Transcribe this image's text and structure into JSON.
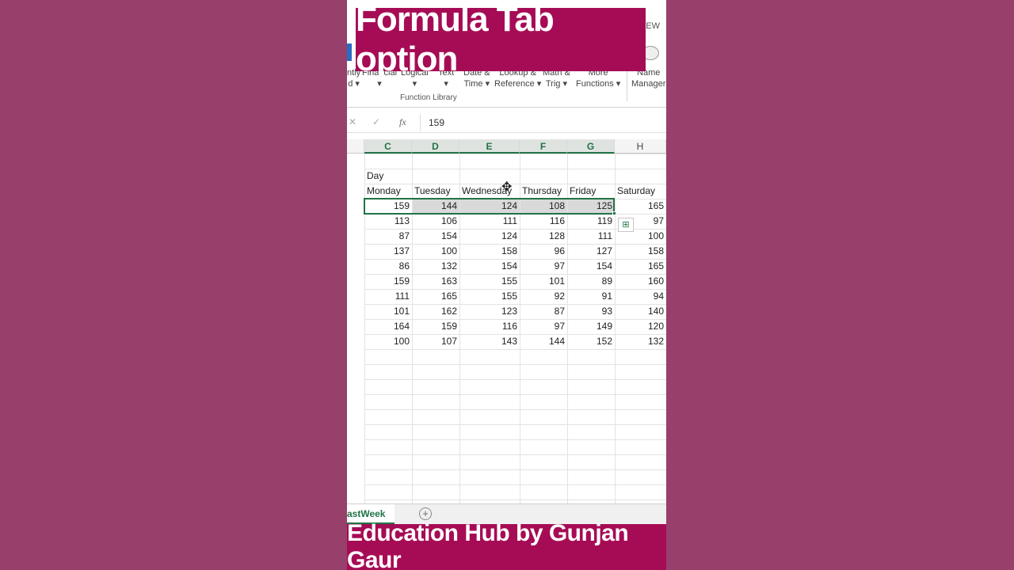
{
  "ribbon": {
    "tab_view": "EW",
    "buttons": [
      {
        "line1": "ntly",
        "line2": "d ▾"
      },
      {
        "line1": "Financial",
        "line2": "▾"
      },
      {
        "line1": "Logical",
        "line2": "▾"
      },
      {
        "line1": "Text",
        "line2": "▾"
      },
      {
        "line1": "Date &",
        "line2": "Time ▾"
      },
      {
        "line1": "Lookup &",
        "line2": "Reference ▾"
      },
      {
        "line1": "Math &",
        "line2": "Trig ▾"
      },
      {
        "line1": "More",
        "line2": "Functions ▾"
      },
      {
        "line1": "Name",
        "line2": "Manager"
      }
    ],
    "group_label": "Function Library"
  },
  "title_banner": "Formula Tab option",
  "formula_bar": {
    "cancel": "✕",
    "enter": "✓",
    "fx": "fx",
    "value": "159"
  },
  "columns": [
    "C",
    "D",
    "E",
    "F",
    "G",
    "H"
  ],
  "table": {
    "group_label": "Day",
    "headers": [
      "Monday",
      "Tuesday",
      "Wednesday",
      "Thursday",
      "Friday",
      "Saturday"
    ],
    "rows": [
      [
        "159",
        "144",
        "124",
        "108",
        "125",
        "165"
      ],
      [
        "113",
        "106",
        "111",
        "116",
        "119",
        "97"
      ],
      [
        "87",
        "154",
        "124",
        "128",
        "111",
        "100"
      ],
      [
        "137",
        "100",
        "158",
        "96",
        "127",
        "158"
      ],
      [
        "86",
        "132",
        "154",
        "97",
        "154",
        "165"
      ],
      [
        "159",
        "163",
        "155",
        "101",
        "89",
        "160"
      ],
      [
        "111",
        "165",
        "155",
        "92",
        "91",
        "94"
      ],
      [
        "101",
        "162",
        "123",
        "87",
        "93",
        "140"
      ],
      [
        "164",
        "159",
        "116",
        "97",
        "149",
        "120"
      ],
      [
        "100",
        "107",
        "143",
        "144",
        "152",
        "132"
      ]
    ]
  },
  "sheet_tab": "astWeek",
  "add_sheet": "+",
  "bottom_banner": "Education Hub by Gunjan Gaur",
  "colors": {
    "background": "#96406b",
    "banner": "#a60c55",
    "excel_green": "#217346"
  }
}
